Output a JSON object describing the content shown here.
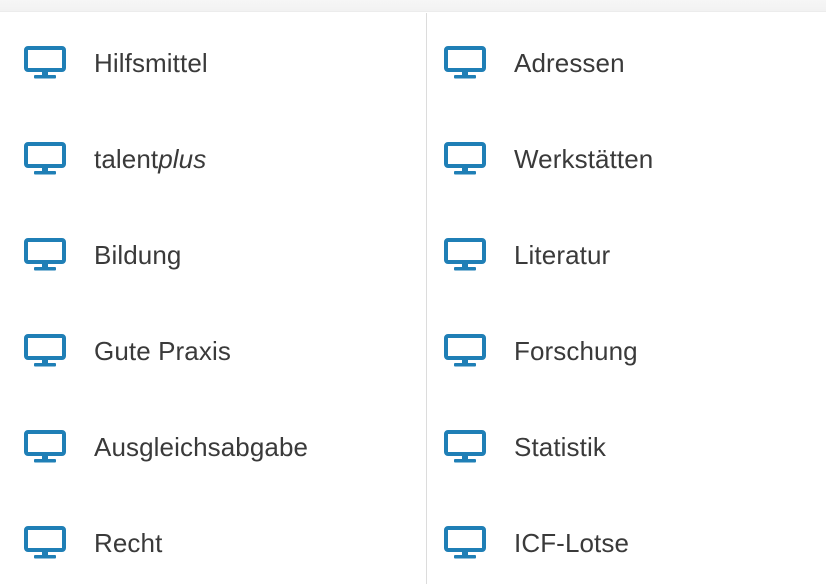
{
  "accent_color": "#1f7fb6",
  "text_color": "#3a3a3a",
  "icon_name": "monitor-icon",
  "left_column": [
    {
      "label": "Hilfsmittel"
    },
    {
      "label_plain": "talent",
      "label_italic": "plus"
    },
    {
      "label": "Bildung"
    },
    {
      "label": "Gute Praxis"
    },
    {
      "label": "Ausgleichsabgabe"
    },
    {
      "label": "Recht"
    }
  ],
  "right_column": [
    {
      "label": "Adressen"
    },
    {
      "label": "Werkstätten"
    },
    {
      "label": "Literatur"
    },
    {
      "label": "Forschung"
    },
    {
      "label": "Statistik"
    },
    {
      "label": "ICF-Lotse"
    }
  ]
}
